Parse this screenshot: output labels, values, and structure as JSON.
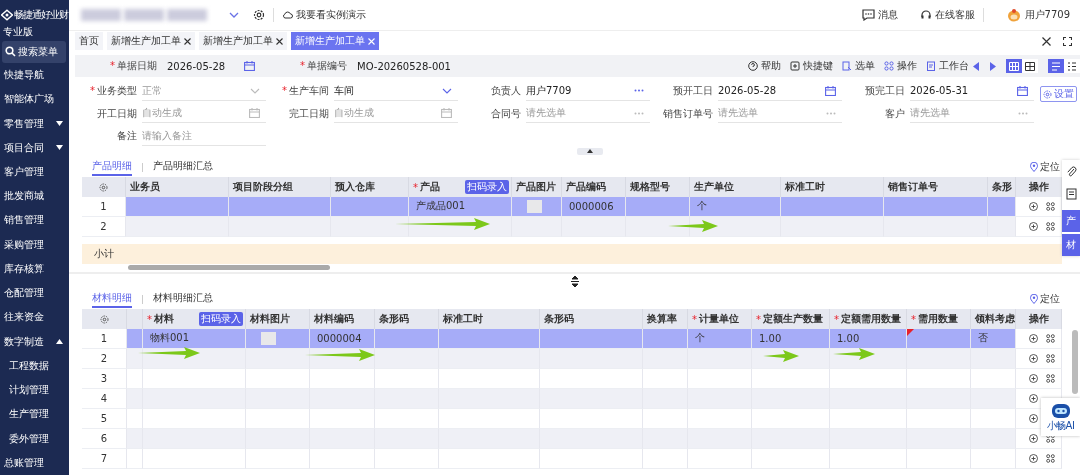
{
  "app": {
    "brand": "畅捷通好业财",
    "edition": "专业版"
  },
  "sidebar": {
    "search": "搜索菜单",
    "items": [
      {
        "label": "快捷导航"
      },
      {
        "label": "智能体广场"
      },
      {
        "label": "零售管理",
        "expanded": false
      },
      {
        "label": "项目合同",
        "expanded": false
      },
      {
        "label": "客户管理"
      },
      {
        "label": "批发商城"
      },
      {
        "label": "销售管理"
      },
      {
        "label": "采购管理"
      },
      {
        "label": "库存核算"
      },
      {
        "label": "仓配管理"
      },
      {
        "label": "往来资金"
      },
      {
        "label": "数字制造",
        "expanded": true,
        "children": [
          {
            "label": "工程数据"
          },
          {
            "label": "计划管理"
          },
          {
            "label": "生产管理"
          },
          {
            "label": "委外管理"
          }
        ]
      },
      {
        "label": "总账管理"
      }
    ]
  },
  "topbar": {
    "demo": "我要看实例演示",
    "messages": "消息",
    "support": "在线客服",
    "user": "用户7709"
  },
  "tabs": [
    {
      "label": "首页",
      "closable": false,
      "selected": false
    },
    {
      "label": "新增生产加工单",
      "closable": true,
      "selected": false
    },
    {
      "label": "新增生产加工单",
      "closable": true,
      "selected": false
    },
    {
      "label": "新增生产加工单",
      "closable": true,
      "selected": true
    }
  ],
  "toolbar": {
    "fields": [
      {
        "label": "单据日期",
        "required_mark": "*",
        "value": "2026-05-28",
        "kind": "date"
      },
      {
        "label": "单据编号",
        "required_mark": "*",
        "value": "MO-20260528-001",
        "kind": "text"
      }
    ],
    "actions": [
      {
        "label": "帮助",
        "kind": "help"
      },
      {
        "label": "快捷键",
        "kind": "keyboard"
      },
      {
        "label": "选单",
        "kind": "select"
      },
      {
        "label": "操作",
        "kind": "ops"
      },
      {
        "label": "工作台",
        "kind": "desk"
      }
    ],
    "layout_views": [
      {
        "selected": true
      },
      {
        "selected": false
      }
    ],
    "form_views": [
      {
        "selected": true
      },
      {
        "selected": false
      }
    ]
  },
  "form": {
    "settings": "设置",
    "rows": [
      [
        {
          "label": "业务类型",
          "required_mark": "*",
          "value": "正常",
          "kind": "select",
          "disabled": true
        },
        {
          "label": "生产车间",
          "required_mark": "*",
          "value": "车间",
          "kind": "select",
          "disabled": false
        },
        {
          "label": "负责人",
          "value": "用户7709",
          "kind": "picker"
        },
        {
          "label": "预开工日",
          "value": "2026-05-28",
          "kind": "date"
        },
        {
          "label": "预完工日",
          "value": "2026-05-31",
          "kind": "date"
        }
      ],
      [
        {
          "label": "开工日期",
          "placeholder": "自动生成",
          "kind": "date"
        },
        {
          "label": "完工日期",
          "placeholder": "自动生成",
          "kind": "date"
        },
        {
          "label": "合同号",
          "placeholder": "请先选单",
          "kind": "picker"
        },
        {
          "label": "销售订单号",
          "placeholder": "请先选单",
          "kind": "picker"
        },
        {
          "label": "客户",
          "placeholder": "请先选单",
          "kind": "picker"
        }
      ],
      [
        {
          "label": "备注",
          "placeholder": "请输入备注",
          "kind": "text"
        }
      ]
    ]
  },
  "product_section": {
    "tabs": [
      {
        "label": "产品明细",
        "selected": true
      },
      {
        "label": "产品明细汇总",
        "selected": false
      }
    ],
    "locate": "定位",
    "columns": [
      {
        "label": "业务员",
        "kind": "text"
      },
      {
        "label": "项目阶段分组",
        "kind": "text"
      },
      {
        "label": "预入仓库",
        "kind": "text"
      },
      {
        "label": "产品",
        "required_mark": "*",
        "kind": "text",
        "badge": "扫码录入"
      },
      {
        "label": "产品图片",
        "kind": "image"
      },
      {
        "label": "产品编码",
        "kind": "text"
      },
      {
        "label": "规格型号",
        "kind": "text"
      },
      {
        "label": "生产单位",
        "kind": "text"
      },
      {
        "label": "标准工时",
        "kind": "text"
      },
      {
        "label": "销售订单号",
        "kind": "text"
      },
      {
        "label": "条形",
        "kind": "text"
      }
    ],
    "ops_label": "操作",
    "rows": [
      {
        "number": "1",
        "selected": true,
        "has_image": true,
        "cells": [
          "",
          "",
          "",
          "产成品001",
          "",
          "0000006",
          "",
          "个",
          "",
          "",
          ""
        ]
      },
      {
        "number": "2",
        "selected": false,
        "has_image": false,
        "cells": [
          "",
          "",
          "",
          "",
          "",
          "",
          "",
          "",
          "",
          "",
          ""
        ]
      }
    ],
    "subtotal": "小计"
  },
  "side_panel": {
    "tabs": [
      {
        "label": "产"
      },
      {
        "label": "材"
      }
    ]
  },
  "material_section": {
    "tabs": [
      {
        "label": "材料明细",
        "selected": true
      },
      {
        "label": "材料明细汇总",
        "selected": false
      }
    ],
    "locate": "定位",
    "columns": [
      {
        "label": "材料",
        "required_mark": "*",
        "kind": "text",
        "badge": "扫码录入"
      },
      {
        "label": "材料图片",
        "kind": "image"
      },
      {
        "label": "材料编码",
        "kind": "text"
      },
      {
        "label": "条形码",
        "kind": "text"
      },
      {
        "label": "标准工时",
        "kind": "text"
      },
      {
        "label": "条形码",
        "kind": "text"
      },
      {
        "label": "换算率",
        "kind": "text"
      },
      {
        "label": "计量单位",
        "required_mark": "*",
        "kind": "text"
      },
      {
        "label": "定额生产数量",
        "required_mark": "*",
        "kind": "text"
      },
      {
        "label": "定额需用数量",
        "required_mark": "*",
        "kind": "text"
      },
      {
        "label": "需用数量",
        "required_mark": "*",
        "kind": "text",
        "validated": true
      },
      {
        "label": "领料考虑",
        "kind": "text"
      }
    ],
    "ops_label": "操作",
    "rows": [
      {
        "number": "1",
        "selected": true,
        "has_image": true,
        "invalid": true,
        "cells": [
          "物料001",
          "",
          "0000004",
          "",
          "",
          "",
          "",
          "个",
          "1.00",
          "1.00",
          "",
          "否"
        ]
      },
      {
        "number": "2",
        "selected": false,
        "has_image": false,
        "invalid": false,
        "cells": [
          "",
          "",
          "",
          "",
          "",
          "",
          "",
          "",
          "",
          "",
          "",
          ""
        ]
      },
      {
        "number": "3",
        "selected": false,
        "has_image": false,
        "invalid": false,
        "cells": [
          "",
          "",
          "",
          "",
          "",
          "",
          "",
          "",
          "",
          "",
          "",
          ""
        ]
      },
      {
        "number": "4",
        "selected": false,
        "has_image": false,
        "invalid": false,
        "cells": [
          "",
          "",
          "",
          "",
          "",
          "",
          "",
          "",
          "",
          "",
          "",
          ""
        ]
      },
      {
        "number": "5",
        "selected": false,
        "has_image": false,
        "invalid": false,
        "cells": [
          "",
          "",
          "",
          "",
          "",
          "",
          "",
          "",
          "",
          "",
          "",
          ""
        ]
      },
      {
        "number": "6",
        "selected": false,
        "has_image": false,
        "invalid": false,
        "cells": [
          "",
          "",
          "",
          "",
          "",
          "",
          "",
          "",
          "",
          "",
          "",
          ""
        ]
      },
      {
        "number": "7",
        "selected": false,
        "has_image": false,
        "invalid": false,
        "cells": [
          "",
          "",
          "",
          "",
          "",
          "",
          "",
          "",
          "",
          "",
          "",
          ""
        ]
      }
    ]
  },
  "assistant": {
    "label": "小畅AI"
  }
}
